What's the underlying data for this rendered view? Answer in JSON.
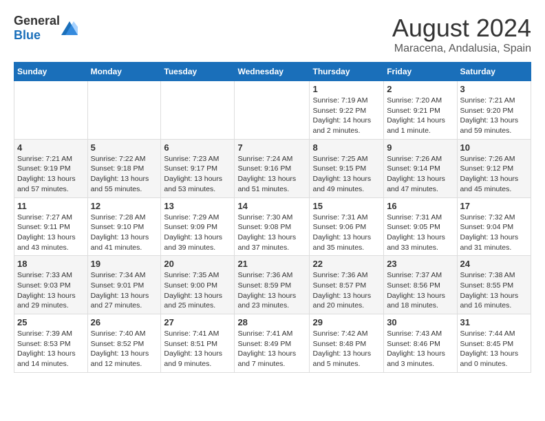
{
  "header": {
    "logo_general": "General",
    "logo_blue": "Blue",
    "month_year": "August 2024",
    "location": "Maracena, Andalusia, Spain"
  },
  "days_of_week": [
    "Sunday",
    "Monday",
    "Tuesday",
    "Wednesday",
    "Thursday",
    "Friday",
    "Saturday"
  ],
  "weeks": [
    [
      {
        "day": "",
        "info": ""
      },
      {
        "day": "",
        "info": ""
      },
      {
        "day": "",
        "info": ""
      },
      {
        "day": "",
        "info": ""
      },
      {
        "day": "1",
        "info": "Sunrise: 7:19 AM\nSunset: 9:22 PM\nDaylight: 14 hours\nand 2 minutes."
      },
      {
        "day": "2",
        "info": "Sunrise: 7:20 AM\nSunset: 9:21 PM\nDaylight: 14 hours\nand 1 minute."
      },
      {
        "day": "3",
        "info": "Sunrise: 7:21 AM\nSunset: 9:20 PM\nDaylight: 13 hours\nand 59 minutes."
      }
    ],
    [
      {
        "day": "4",
        "info": "Sunrise: 7:21 AM\nSunset: 9:19 PM\nDaylight: 13 hours\nand 57 minutes."
      },
      {
        "day": "5",
        "info": "Sunrise: 7:22 AM\nSunset: 9:18 PM\nDaylight: 13 hours\nand 55 minutes."
      },
      {
        "day": "6",
        "info": "Sunrise: 7:23 AM\nSunset: 9:17 PM\nDaylight: 13 hours\nand 53 minutes."
      },
      {
        "day": "7",
        "info": "Sunrise: 7:24 AM\nSunset: 9:16 PM\nDaylight: 13 hours\nand 51 minutes."
      },
      {
        "day": "8",
        "info": "Sunrise: 7:25 AM\nSunset: 9:15 PM\nDaylight: 13 hours\nand 49 minutes."
      },
      {
        "day": "9",
        "info": "Sunrise: 7:26 AM\nSunset: 9:14 PM\nDaylight: 13 hours\nand 47 minutes."
      },
      {
        "day": "10",
        "info": "Sunrise: 7:26 AM\nSunset: 9:12 PM\nDaylight: 13 hours\nand 45 minutes."
      }
    ],
    [
      {
        "day": "11",
        "info": "Sunrise: 7:27 AM\nSunset: 9:11 PM\nDaylight: 13 hours\nand 43 minutes."
      },
      {
        "day": "12",
        "info": "Sunrise: 7:28 AM\nSunset: 9:10 PM\nDaylight: 13 hours\nand 41 minutes."
      },
      {
        "day": "13",
        "info": "Sunrise: 7:29 AM\nSunset: 9:09 PM\nDaylight: 13 hours\nand 39 minutes."
      },
      {
        "day": "14",
        "info": "Sunrise: 7:30 AM\nSunset: 9:08 PM\nDaylight: 13 hours\nand 37 minutes."
      },
      {
        "day": "15",
        "info": "Sunrise: 7:31 AM\nSunset: 9:06 PM\nDaylight: 13 hours\nand 35 minutes."
      },
      {
        "day": "16",
        "info": "Sunrise: 7:31 AM\nSunset: 9:05 PM\nDaylight: 13 hours\nand 33 minutes."
      },
      {
        "day": "17",
        "info": "Sunrise: 7:32 AM\nSunset: 9:04 PM\nDaylight: 13 hours\nand 31 minutes."
      }
    ],
    [
      {
        "day": "18",
        "info": "Sunrise: 7:33 AM\nSunset: 9:03 PM\nDaylight: 13 hours\nand 29 minutes."
      },
      {
        "day": "19",
        "info": "Sunrise: 7:34 AM\nSunset: 9:01 PM\nDaylight: 13 hours\nand 27 minutes."
      },
      {
        "day": "20",
        "info": "Sunrise: 7:35 AM\nSunset: 9:00 PM\nDaylight: 13 hours\nand 25 minutes."
      },
      {
        "day": "21",
        "info": "Sunrise: 7:36 AM\nSunset: 8:59 PM\nDaylight: 13 hours\nand 23 minutes."
      },
      {
        "day": "22",
        "info": "Sunrise: 7:36 AM\nSunset: 8:57 PM\nDaylight: 13 hours\nand 20 minutes."
      },
      {
        "day": "23",
        "info": "Sunrise: 7:37 AM\nSunset: 8:56 PM\nDaylight: 13 hours\nand 18 minutes."
      },
      {
        "day": "24",
        "info": "Sunrise: 7:38 AM\nSunset: 8:55 PM\nDaylight: 13 hours\nand 16 minutes."
      }
    ],
    [
      {
        "day": "25",
        "info": "Sunrise: 7:39 AM\nSunset: 8:53 PM\nDaylight: 13 hours\nand 14 minutes."
      },
      {
        "day": "26",
        "info": "Sunrise: 7:40 AM\nSunset: 8:52 PM\nDaylight: 13 hours\nand 12 minutes."
      },
      {
        "day": "27",
        "info": "Sunrise: 7:41 AM\nSunset: 8:51 PM\nDaylight: 13 hours\nand 9 minutes."
      },
      {
        "day": "28",
        "info": "Sunrise: 7:41 AM\nSunset: 8:49 PM\nDaylight: 13 hours\nand 7 minutes."
      },
      {
        "day": "29",
        "info": "Sunrise: 7:42 AM\nSunset: 8:48 PM\nDaylight: 13 hours\nand 5 minutes."
      },
      {
        "day": "30",
        "info": "Sunrise: 7:43 AM\nSunset: 8:46 PM\nDaylight: 13 hours\nand 3 minutes."
      },
      {
        "day": "31",
        "info": "Sunrise: 7:44 AM\nSunset: 8:45 PM\nDaylight: 13 hours\nand 0 minutes."
      }
    ]
  ]
}
